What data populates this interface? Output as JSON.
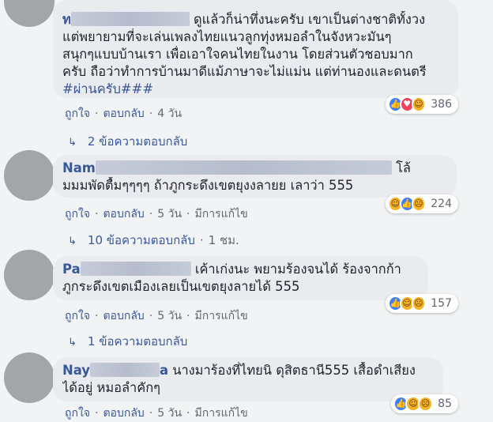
{
  "comments": [
    {
      "name": "ท",
      "lines": [
        "ดูแล้วก็น่าทึ่งนะครับ เขาเป็นต่างชาติทั้งวง",
        "แต่พยายามที่จะเล่นเพลงไทยแนวลูกทุ่งหมอลำในจังหวะมันๆ",
        "สนุกๆแบบบ้านเรา เพื่อเอาใจคนไทยในงาน โดยส่วนตัวชอบมาก",
        "ครับ ถือว่าทำการบ้านมาดีแม้ภาษาจะไม่แม่น แต่ท่านองและดนตรี"
      ],
      "hashtag": "#ผ่านครับ###",
      "reaction_count": "386",
      "like": "ถูกใจ",
      "reply": "ตอบกลับ",
      "time": "4 วัน",
      "replies_link": "2 ข้อความตอบกลับ"
    },
    {
      "name": "Nam",
      "lines": [
        "โล้",
        "มมมพัดตื้มๆๆๆๆ ถ้าภูกระดึงเขตยุงงลายย เลาว่า 555"
      ],
      "reaction_count": "224",
      "like": "ถูกใจ",
      "reply": "ตอบกลับ",
      "time": "5 วัน",
      "edited": "มีการแก้ไข",
      "replies_link": "10 ข้อความตอบกลับ",
      "replies_time": "1 ชม."
    },
    {
      "name": "Pa",
      "lines": [
        "เค้าเก่งนะ พยามร้องจนได้ ร้องจากก้า",
        "ภูกระดึงเขตเมืองเลยเป็นเขตยุงลายได้ 555"
      ],
      "reaction_count": "157",
      "like": "ถูกใจ",
      "reply": "ตอบกลับ",
      "time": "5 วัน",
      "edited": "มีการแก้ไข",
      "replies_link": "1 ข้อความตอบกลับ"
    },
    {
      "name": "Nay",
      "name_suffix": "a",
      "lines": [
        "นางมาร้องที่ไทยนิ ดุสิตธานี555 เสื้อดำเสียง",
        "ได้อยู่ หมอลำคักๆ"
      ],
      "reaction_count": "85",
      "like": "ถูกใจ",
      "reply": "ตอบกลับ",
      "time": "5 วัน",
      "edited": "มีการแก้ไข"
    }
  ],
  "icons": {
    "like": "like-icon",
    "love": "love-icon",
    "haha": "haha-icon",
    "sad": "sad-icon",
    "reply_arrow": "reply-arrow-icon"
  },
  "colors": {
    "link": "#385898",
    "bubble": "#e9ebee",
    "meta": "#606770",
    "like": "#4080ff",
    "love": "#f0415d",
    "haha": "#f7b125"
  }
}
